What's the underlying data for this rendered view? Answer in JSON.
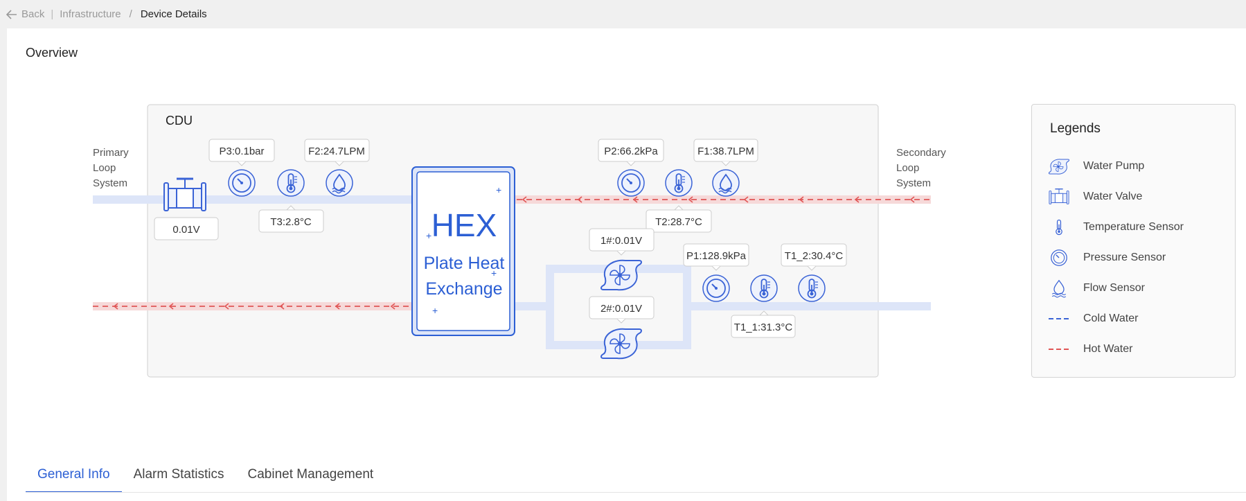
{
  "breadcrumb": {
    "back": "Back",
    "parent": "Infrastructure",
    "current": "Device Details"
  },
  "overview": {
    "title": "Overview"
  },
  "diagram": {
    "cdu_label": "CDU",
    "primary_label": [
      "Primary",
      "Loop",
      "System"
    ],
    "secondary_label": [
      "Secondary",
      "Loop",
      "System"
    ],
    "valve_value": "0.01V",
    "p3": "P3:0.1bar",
    "f2": "F2:24.7LPM",
    "t3": "T3:2.8°C",
    "p2": "P2:66.2kPa",
    "f1": "F1:38.7LPM",
    "t2": "T2:28.7°C",
    "pump1": "1#:0.01V",
    "pump2": "2#:0.01V",
    "p1": "P1:128.9kPa",
    "t1_2": "T1_2:30.4°C",
    "t1_1": "T1_1:31.3°C",
    "hex_title": "HEX",
    "hex_line1": "Plate Heat",
    "hex_line2": "Exchange"
  },
  "legend": {
    "title": "Legends",
    "items": [
      {
        "label": "Water Pump",
        "icon": "water-pump-icon"
      },
      {
        "label": "Water Valve",
        "icon": "water-valve-icon"
      },
      {
        "label": "Temperature Sensor",
        "icon": "thermometer-icon"
      },
      {
        "label": "Pressure Sensor",
        "icon": "gauge-icon"
      },
      {
        "label": "Flow Sensor",
        "icon": "water-drop-icon"
      },
      {
        "label": "Cold Water",
        "icon": "cold-water-line-icon"
      },
      {
        "label": "Hot Water",
        "icon": "hot-water-line-icon"
      }
    ]
  },
  "colors": {
    "accent": "#2c5fd4",
    "cold_pipe": "#dde5f8",
    "hot_pipe": "#f6d9d9",
    "hot_line": "#e05555",
    "cold_line": "#3a63d6"
  },
  "tabs": [
    "General Info",
    "Alarm Statistics",
    "Cabinet Management"
  ]
}
